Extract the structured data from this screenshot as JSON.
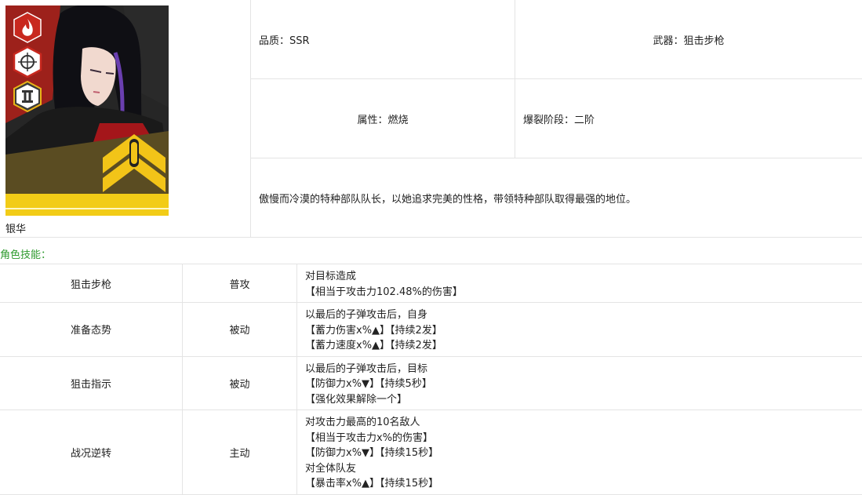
{
  "character": {
    "name": "银华",
    "portrait_alt": "character-portrait"
  },
  "info": {
    "rarity": "品质：SSR",
    "weapon": "武器：狙击步枪",
    "element": "属性：燃烧",
    "burst": "爆裂阶段：二阶",
    "description": "傲慢而冷漠的特种部队队长，以她追求完美的性格，带领特种部队取得最强的地位。"
  },
  "skills_section_title": "角色技能：",
  "skills": [
    {
      "name": "狙击步枪",
      "type": "普攻",
      "lines": [
        "对目标造成",
        "【相当于攻击力102.48%的伤害】"
      ]
    },
    {
      "name": "准备态势",
      "type": "被动",
      "lines": [
        "以最后的子弹攻击后，自身",
        "【蓄力伤害x%▲】【持续2发】",
        "【蓄力速度x%▲】【持续2发】"
      ]
    },
    {
      "name": "狙击指示",
      "type": "被动",
      "lines": [
        "以最后的子弹攻击后，目标",
        "【防御力x%▼】【持续5秒】",
        "【强化效果解除一个】"
      ]
    },
    {
      "name": "战况逆转",
      "type": "主动",
      "lines": [
        "对攻击力最高的10名敌人",
        "【相当于攻击力x%的伤害】",
        "【防御力x%▼】【持续15秒】",
        "对全体队友",
        "【暴击率x%▲】【持续15秒】"
      ]
    }
  ],
  "colors": {
    "section_title": "#2e9a2e",
    "border": "#e4e4e4",
    "badge_red": "#c8281e",
    "badge_gold": "#e8b418"
  },
  "icons": [
    "fire-element-icon",
    "sniper-scope-icon",
    "burst-stage-2-icon",
    "company-emblem-icon"
  ]
}
